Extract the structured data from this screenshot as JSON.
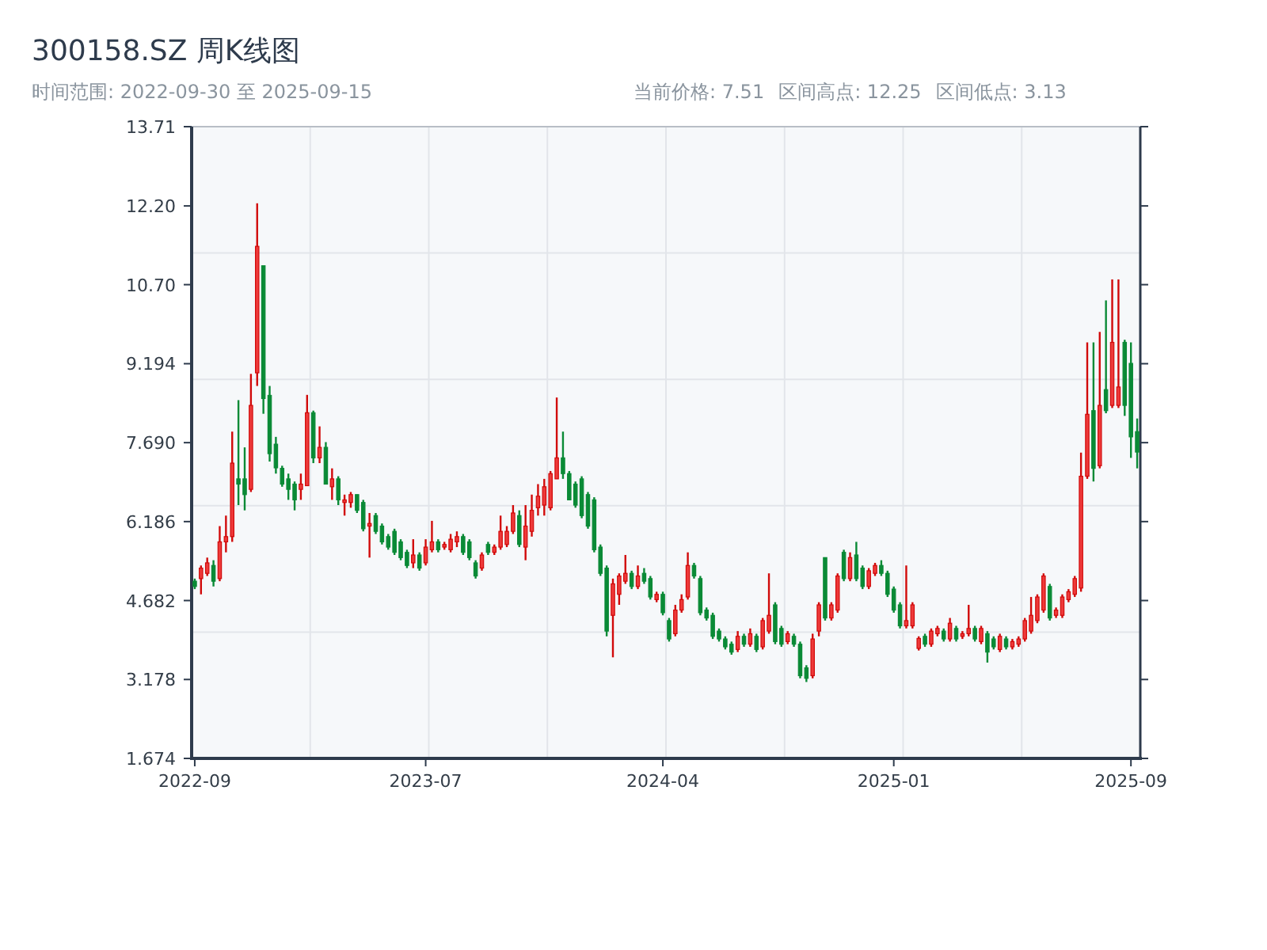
{
  "title": "300158.SZ 周K线图",
  "range": "时间范围: 2022-09-30 至 2025-09-15",
  "stats": [
    "当前价格: 7.51",
    "区间高点: 12.25",
    "区间低点: 3.13"
  ],
  "chart": {
    "chart_data": {
      "type": "candlestick",
      "ylim": [
        1.674,
        13.71
      ],
      "yticks": [
        {
          "value": 1.674,
          "label": "1.674"
        },
        {
          "value": 3.178,
          "label": "3.178"
        },
        {
          "value": 4.682,
          "label": "4.682"
        },
        {
          "value": 6.186,
          "label": "6.186"
        },
        {
          "value": 7.69,
          "label": "7.690"
        },
        {
          "value": 9.194,
          "label": "9.194"
        },
        {
          "value": 10.7,
          "label": "10.70"
        },
        {
          "value": 12.2,
          "label": "12.20"
        },
        {
          "value": 13.71,
          "label": "13.71"
        }
      ],
      "categories": [
        "2022-09",
        null,
        null,
        null,
        null,
        null,
        null,
        null,
        null,
        null,
        null,
        null,
        null,
        null,
        null,
        null,
        null,
        null,
        null,
        null,
        null,
        null,
        null,
        null,
        null,
        null,
        null,
        null,
        null,
        null,
        null,
        null,
        null,
        null,
        null,
        null,
        null,
        "2023-07",
        null,
        null,
        null,
        null,
        null,
        null,
        null,
        null,
        null,
        null,
        null,
        null,
        null,
        null,
        null,
        null,
        null,
        null,
        null,
        null,
        null,
        null,
        null,
        null,
        null,
        null,
        null,
        null,
        null,
        null,
        null,
        null,
        null,
        null,
        null,
        null,
        null,
        "2024-04",
        null,
        null,
        null,
        null,
        null,
        null,
        null,
        null,
        null,
        null,
        null,
        null,
        null,
        null,
        null,
        null,
        null,
        null,
        null,
        null,
        null,
        null,
        null,
        null,
        null,
        null,
        null,
        null,
        null,
        null,
        null,
        null,
        null,
        null,
        null,
        null,
        "2025-01",
        null,
        null,
        null,
        null,
        null,
        null,
        null,
        null,
        null,
        null,
        null,
        null,
        null,
        null,
        null,
        null,
        null,
        null,
        null,
        null,
        null,
        null,
        null,
        null,
        null,
        null,
        null,
        null,
        null,
        null,
        null,
        null,
        null,
        null,
        null,
        null,
        null,
        "2025-09",
        null
      ],
      "ohlc": [
        [
          5.05,
          5.1,
          4.9,
          4.95
        ],
        [
          5.1,
          5.35,
          4.8,
          5.3
        ],
        [
          5.2,
          5.5,
          5.15,
          5.4
        ],
        [
          5.35,
          5.45,
          4.95,
          5.05
        ],
        [
          5.1,
          6.1,
          5.05,
          5.8
        ],
        [
          5.8,
          6.3,
          5.6,
          5.9
        ],
        [
          5.9,
          7.9,
          5.8,
          7.3
        ],
        [
          7.0,
          8.5,
          6.5,
          6.9
        ],
        [
          7.0,
          7.6,
          6.4,
          6.7
        ],
        [
          6.8,
          9.0,
          6.75,
          8.4
        ],
        [
          9.02,
          12.25,
          8.77,
          11.43
        ],
        [
          11.06,
          11.06,
          8.24,
          8.53
        ],
        [
          8.59,
          8.77,
          7.33,
          7.48
        ],
        [
          7.66,
          7.8,
          7.1,
          7.21
        ],
        [
          7.2,
          7.25,
          6.85,
          6.9
        ],
        [
          7.0,
          7.1,
          6.6,
          6.8
        ],
        [
          6.9,
          6.95,
          6.4,
          6.6
        ],
        [
          6.8,
          7.1,
          6.6,
          6.9
        ],
        [
          6.87,
          8.6,
          6.87,
          8.26
        ],
        [
          8.26,
          8.3,
          7.3,
          7.4
        ],
        [
          7.4,
          8.0,
          7.3,
          7.6
        ],
        [
          7.6,
          7.7,
          6.9,
          6.9
        ],
        [
          6.85,
          7.2,
          6.6,
          7.0
        ],
        [
          7.0,
          7.05,
          6.5,
          6.6
        ],
        [
          6.55,
          6.7,
          6.3,
          6.6
        ],
        [
          6.55,
          6.75,
          6.45,
          6.7
        ],
        [
          6.7,
          6.7,
          6.35,
          6.4
        ],
        [
          6.55,
          6.6,
          6.0,
          6.05
        ],
        [
          6.1,
          6.35,
          5.5,
          6.15
        ],
        [
          6.3,
          6.35,
          5.95,
          6.0
        ],
        [
          6.1,
          6.15,
          5.75,
          5.8
        ],
        [
          5.9,
          5.95,
          5.65,
          5.7
        ],
        [
          6.0,
          6.05,
          5.55,
          5.6
        ],
        [
          5.8,
          5.85,
          5.45,
          5.5
        ],
        [
          5.6,
          5.65,
          5.3,
          5.35
        ],
        [
          5.4,
          5.85,
          5.3,
          5.55
        ],
        [
          5.55,
          5.6,
          5.25,
          5.3
        ],
        [
          5.4,
          5.85,
          5.35,
          5.7
        ],
        [
          5.65,
          6.2,
          5.6,
          5.8
        ],
        [
          5.8,
          5.85,
          5.6,
          5.65
        ],
        [
          5.7,
          5.8,
          5.65,
          5.75
        ],
        [
          5.65,
          5.95,
          5.6,
          5.85
        ],
        [
          5.8,
          6.0,
          5.7,
          5.9
        ],
        [
          5.9,
          5.95,
          5.55,
          5.6
        ],
        [
          5.8,
          5.85,
          5.45,
          5.5
        ],
        [
          5.4,
          5.45,
          5.1,
          5.15
        ],
        [
          5.3,
          5.6,
          5.25,
          5.55
        ],
        [
          5.75,
          5.8,
          5.55,
          5.6
        ],
        [
          5.6,
          5.75,
          5.55,
          5.7
        ],
        [
          5.7,
          6.3,
          5.65,
          6.0
        ],
        [
          5.75,
          6.1,
          5.7,
          6.0
        ],
        [
          6.0,
          6.5,
          5.95,
          6.35
        ],
        [
          6.3,
          6.4,
          5.7,
          5.75
        ],
        [
          5.7,
          6.5,
          5.45,
          6.1
        ],
        [
          6.0,
          6.7,
          5.9,
          6.4
        ],
        [
          6.45,
          6.9,
          6.3,
          6.67
        ],
        [
          6.5,
          7.0,
          6.3,
          6.85
        ],
        [
          6.45,
          7.15,
          6.4,
          7.1
        ],
        [
          7.0,
          8.55,
          7.0,
          7.4
        ],
        [
          7.4,
          7.9,
          7.0,
          7.1
        ],
        [
          7.1,
          7.15,
          6.6,
          6.6
        ],
        [
          6.9,
          6.95,
          6.45,
          6.5
        ],
        [
          7.0,
          7.05,
          6.25,
          6.3
        ],
        [
          6.7,
          6.75,
          6.05,
          6.1
        ],
        [
          6.6,
          6.65,
          5.6,
          5.65
        ],
        [
          5.7,
          5.75,
          5.15,
          5.2
        ],
        [
          5.3,
          5.35,
          4.0,
          4.1
        ],
        [
          4.4,
          5.1,
          3.6,
          5.0
        ],
        [
          4.8,
          5.2,
          4.6,
          5.15
        ],
        [
          5.05,
          5.55,
          5.0,
          5.2
        ],
        [
          5.2,
          5.25,
          4.9,
          4.95
        ],
        [
          4.95,
          5.35,
          4.9,
          5.15
        ],
        [
          5.2,
          5.3,
          5.0,
          5.05
        ],
        [
          5.1,
          5.15,
          4.7,
          4.75
        ],
        [
          4.7,
          4.85,
          4.65,
          4.8
        ],
        [
          4.8,
          4.85,
          4.4,
          4.45
        ],
        [
          4.3,
          4.35,
          3.9,
          3.95
        ],
        [
          4.05,
          4.6,
          4.0,
          4.5
        ],
        [
          4.5,
          4.8,
          4.45,
          4.7
        ],
        [
          4.75,
          5.6,
          4.7,
          5.35
        ],
        [
          5.35,
          5.4,
          5.1,
          5.15
        ],
        [
          5.1,
          5.15,
          4.4,
          4.45
        ],
        [
          4.5,
          4.55,
          4.3,
          4.35
        ],
        [
          4.4,
          4.45,
          3.95,
          4.0
        ],
        [
          4.1,
          4.15,
          3.9,
          3.95
        ],
        [
          3.95,
          4.0,
          3.75,
          3.8
        ],
        [
          3.85,
          3.9,
          3.65,
          3.7
        ],
        [
          3.75,
          4.1,
          3.7,
          4.0
        ],
        [
          4.0,
          4.05,
          3.8,
          3.85
        ],
        [
          3.85,
          4.15,
          3.8,
          4.05
        ],
        [
          4.0,
          4.05,
          3.7,
          3.75
        ],
        [
          3.8,
          4.35,
          3.75,
          4.3
        ],
        [
          4.1,
          5.2,
          4.05,
          4.4
        ],
        [
          4.6,
          4.65,
          3.85,
          3.9
        ],
        [
          4.15,
          4.2,
          3.8,
          3.85
        ],
        [
          3.9,
          4.1,
          3.85,
          4.05
        ],
        [
          4.0,
          4.05,
          3.8,
          3.85
        ],
        [
          3.85,
          3.9,
          3.2,
          3.25
        ],
        [
          3.4,
          3.45,
          3.13,
          3.2
        ],
        [
          3.25,
          4.05,
          3.2,
          3.95
        ],
        [
          4.1,
          4.65,
          4.0,
          4.6
        ],
        [
          5.5,
          5.5,
          4.3,
          4.35
        ],
        [
          4.35,
          4.65,
          4.3,
          4.6
        ],
        [
          4.5,
          5.2,
          4.45,
          5.15
        ],
        [
          5.6,
          5.65,
          5.05,
          5.1
        ],
        [
          5.1,
          5.6,
          5.05,
          5.5
        ],
        [
          5.55,
          5.8,
          5.05,
          5.1
        ],
        [
          5.3,
          5.35,
          4.9,
          4.95
        ],
        [
          4.95,
          5.3,
          4.9,
          5.25
        ],
        [
          5.2,
          5.4,
          5.15,
          5.35
        ],
        [
          5.35,
          5.45,
          5.15,
          5.2
        ],
        [
          5.2,
          5.25,
          4.75,
          4.8
        ],
        [
          4.9,
          4.95,
          4.45,
          4.5
        ],
        [
          4.6,
          4.65,
          4.15,
          4.2
        ],
        [
          4.2,
          5.35,
          4.15,
          4.3
        ],
        [
          4.2,
          4.65,
          4.15,
          4.6
        ],
        [
          3.77,
          4.0,
          3.73,
          3.96
        ],
        [
          4.0,
          4.05,
          3.8,
          3.85
        ],
        [
          3.85,
          4.15,
          3.8,
          4.1
        ],
        [
          4.05,
          4.2,
          4.0,
          4.15
        ],
        [
          4.1,
          4.15,
          3.9,
          3.95
        ],
        [
          3.95,
          4.35,
          3.9,
          4.25
        ],
        [
          4.15,
          4.2,
          3.9,
          3.95
        ],
        [
          4.0,
          4.1,
          3.95,
          4.05
        ],
        [
          4.05,
          4.6,
          4.0,
          4.15
        ],
        [
          4.15,
          4.2,
          3.9,
          3.95
        ],
        [
          3.9,
          4.2,
          3.85,
          4.15
        ],
        [
          4.05,
          4.1,
          3.5,
          3.7
        ],
        [
          3.95,
          4.0,
          3.75,
          3.8
        ],
        [
          3.75,
          4.05,
          3.7,
          4.0
        ],
        [
          3.95,
          4.0,
          3.75,
          3.8
        ],
        [
          3.8,
          3.95,
          3.75,
          3.9
        ],
        [
          3.85,
          4.0,
          3.8,
          3.95
        ],
        [
          3.95,
          4.35,
          3.9,
          4.3
        ],
        [
          4.1,
          4.75,
          4.05,
          4.4
        ],
        [
          4.3,
          4.8,
          4.25,
          4.75
        ],
        [
          4.5,
          5.2,
          4.45,
          5.15
        ],
        [
          4.95,
          5.0,
          4.3,
          4.35
        ],
        [
          4.4,
          4.55,
          4.35,
          4.5
        ],
        [
          4.4,
          4.8,
          4.35,
          4.75
        ],
        [
          4.7,
          4.9,
          4.65,
          4.85
        ],
        [
          4.8,
          5.15,
          4.75,
          5.1
        ],
        [
          4.92,
          7.5,
          4.85,
          7.05
        ],
        [
          7.05,
          9.6,
          7.0,
          8.23
        ],
        [
          8.3,
          9.6,
          6.95,
          7.2
        ],
        [
          7.25,
          9.8,
          7.2,
          8.4
        ],
        [
          8.7,
          10.4,
          8.25,
          8.3
        ],
        [
          8.4,
          10.8,
          8.35,
          9.6
        ],
        [
          8.4,
          10.8,
          8.35,
          8.75
        ],
        [
          9.6,
          9.65,
          8.2,
          8.4
        ],
        [
          9.2,
          9.6,
          7.4,
          7.8
        ],
        [
          7.9,
          8.15,
          7.2,
          7.51
        ]
      ]
    }
  }
}
